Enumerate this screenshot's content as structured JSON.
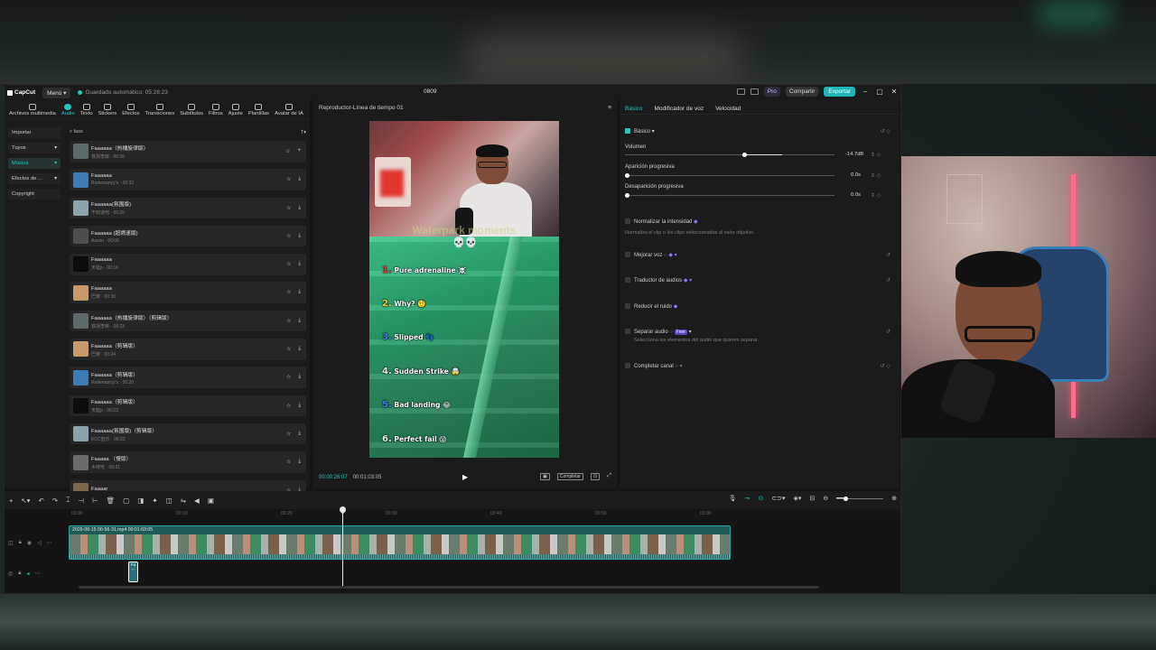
{
  "titlebar": {
    "app_name": "CapCut",
    "menu_label": "Menú",
    "autosave_text": "Guardado automático: 05:28:23",
    "project_title": "0809",
    "pro_label": "Pro",
    "share_label": "Compartir",
    "export_label": "Exportar"
  },
  "toolbar": {
    "tools": [
      "Archivos multimedia",
      "Audio",
      "Texto",
      "Stickers",
      "Efectos",
      "Transiciones",
      "Subtítulos",
      "Filtros",
      "Ajuste",
      "Plantillas",
      "Avatar de IA"
    ],
    "active": "Audio"
  },
  "categories": {
    "items": [
      "Importar",
      "Tuyos",
      "Música",
      "Efectos de ...",
      "Copyright"
    ],
    "active": "Música"
  },
  "search": {
    "query": "fass",
    "filter_label": "T"
  },
  "audio_list": [
    {
      "title": "Faaaaaa（热播旋律版）",
      "meta": "铁拐李麻 · 00:39"
    },
    {
      "title": "Faaaaaa",
      "meta": "Rodemancy's · 00:32"
    },
    {
      "title": "Faaaaaa(氛围版)",
      "meta": "不知道吧 · 00:25"
    },
    {
      "title": "Faaaaaa (超燃速版)",
      "meta": "Auxim · 00:06"
    },
    {
      "title": "Faaaaaa",
      "meta": "天蛙p · 00:16"
    },
    {
      "title": "Faaaaaa",
      "meta": "巴黎 · 00:30"
    },
    {
      "title": "Faaaaaa（热播旋律版）（剪辑版）",
      "meta": "铁拐李麻 · 00:23"
    },
    {
      "title": "Faaaaaa（剪辑版）",
      "meta": "巴黎 · 00:24"
    },
    {
      "title": "Faaaaaa（剪辑版）",
      "meta": "Rodemancy's · 00:20"
    },
    {
      "title": "Faaaaaa（剪辑版）",
      "meta": "天蛙p · 00:23"
    },
    {
      "title": "Faaaaaa(氛围版)（剪辑版）",
      "meta": "KCC音乐 · 00:23"
    },
    {
      "title": "Faaaaa （慢版）",
      "meta": "木吱吱 · 00:31"
    },
    {
      "title": "Faaaar",
      "meta": ""
    }
  ],
  "player": {
    "title": "Reproductor-Línea de tiempo 01",
    "current_time": "00:00:26:07",
    "total_time": "00:01:03:05",
    "ratio_label": "Completar",
    "overlay_heading": "Waterpark moments",
    "overlay_skulls": "💀💀",
    "list": [
      {
        "num": "1.",
        "text": "Pure adrenaline ☠️"
      },
      {
        "num": "2.",
        "text": "Why? 🤨"
      },
      {
        "num": "3.",
        "text": "Slipped 👣"
      },
      {
        "num": "4.",
        "text": "Sudden Strike 🤯"
      },
      {
        "num": "5.",
        "text": "Bad landing 😂"
      },
      {
        "num": "6.",
        "text": "Perfect fail 😱"
      }
    ]
  },
  "props": {
    "tabs": [
      "Básico",
      "Modificador de voz",
      "Velocidad"
    ],
    "active_tab": "Básico",
    "section_title": "Básico",
    "volume_label": "Volumen",
    "volume_value": "-14.7dB",
    "volume_level": 0.58,
    "fade_in_label": "Aparición progresiva",
    "fade_in_value": "0.0s",
    "fade_out_label": "Desaparición progresiva",
    "fade_out_value": "0.0s",
    "normalize_label": "Normalizar la intensidad",
    "normalize_desc": "Normaliza el clip o los clips seleccionados al valor objetivo.",
    "enhance_label": "Mejorar voz",
    "translate_label": "Traductor de audios",
    "reduce_noise_label": "Reducir el ruido",
    "separate_label": "Separar audio",
    "separate_badge": "Free",
    "separate_desc": "Selecciona los elementos del audio que quieres separar.",
    "channel_label": "Completar canal"
  },
  "timeline": {
    "ruler_labels": [
      "00:00",
      "00:10",
      "00:20",
      "00:30",
      "00:40",
      "00:50",
      "01:00"
    ],
    "clip_label": "2026-08-15 00-56-31.mp4   00:01:03:05",
    "audio_clip_label": "Fa",
    "playhead_position": 0.415
  }
}
